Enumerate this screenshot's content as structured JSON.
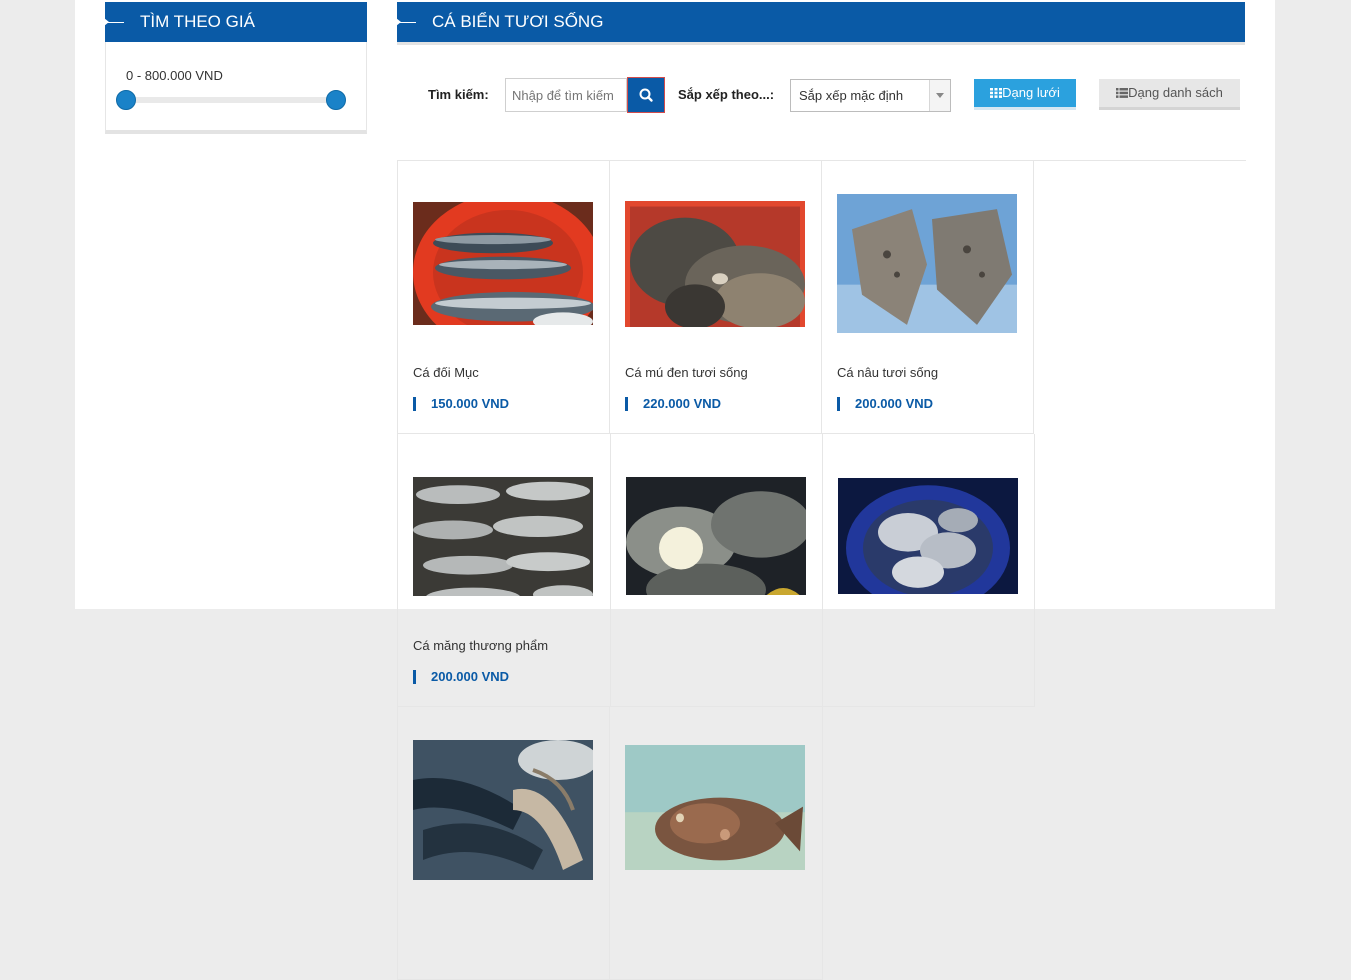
{
  "sidebar": {
    "price_filter": {
      "title": "TÌM THEO GIÁ",
      "range_text": "0 - 800.000 VND",
      "min_value": 0,
      "max_value": 800000
    }
  },
  "main": {
    "title": "CÁ BIỂN TƯƠI SỐNG",
    "toolbar": {
      "search_label": "Tìm kiếm:",
      "search_placeholder": "Nhập để tìm kiếm",
      "sort_label": "Sắp xếp theo...:",
      "sort_value": "Sắp xếp mặc định",
      "grid_view_label": "Dạng lưới",
      "list_view_label": "Dạng danh sách"
    },
    "products": [
      {
        "name": "Cá đối Mục",
        "price": "150.000 VND"
      },
      {
        "name": "Cá mú đen tươi sống",
        "price": "220.000 VND"
      },
      {
        "name": "Cá nâu tươi sống",
        "price": "200.000 VND"
      },
      {
        "name": "Cá măng thương phẩm",
        "price": "200.000 VND"
      },
      {
        "name": "",
        "price": ""
      },
      {
        "name": "",
        "price": ""
      },
      {
        "name": "",
        "price": ""
      },
      {
        "name": "",
        "price": ""
      }
    ]
  },
  "colors": {
    "brand_blue": "#0a5aa6",
    "active_button": "#2ba1de",
    "slider_handle": "#1a82c8"
  },
  "icons": [
    "search-icon",
    "grid-icon",
    "list-icon",
    "dropdown-arrow-icon"
  ]
}
